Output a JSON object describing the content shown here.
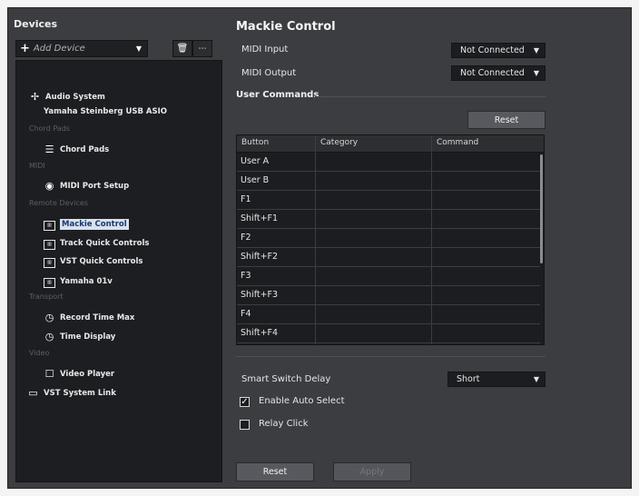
{
  "devices_panel": {
    "title": "Devices",
    "add_device_label": "Add Device",
    "tree": {
      "audio_system": "Audio System",
      "audio_driver": "Yamaha Steinberg USB ASIO",
      "cat_chord_pads": "Chord Pads",
      "chord_pads": "Chord Pads",
      "cat_midi": "MIDI",
      "midi_port_setup": "MIDI Port Setup",
      "cat_remote_devices": "Remote Devices",
      "mackie_control": "Mackie Control",
      "track_quick_controls": "Track Quick Controls",
      "vst_quick_controls": "VST Quick Controls",
      "yamaha_01v": "Yamaha 01v",
      "cat_transport": "Transport",
      "record_time_max": "Record Time Max",
      "time_display": "Time Display",
      "cat_video": "Video",
      "video_player": "Video Player",
      "vst_system_link": "VST System Link"
    }
  },
  "settings": {
    "title": "Mackie Control",
    "midi_input_label": "MIDI Input",
    "midi_input_value": "Not Connected",
    "midi_output_label": "MIDI Output",
    "midi_output_value": "Not Connected",
    "user_commands_label": "User Commands",
    "reset_top_label": "Reset",
    "table": {
      "columns": [
        "Button",
        "Category",
        "Command"
      ],
      "rows": [
        "User A",
        "User B",
        "F1",
        "Shift+F1",
        "F2",
        "Shift+F2",
        "F3",
        "Shift+F3",
        "F4",
        "Shift+F4"
      ]
    },
    "smart_switch_delay_label": "Smart Switch Delay",
    "smart_switch_delay_value": "Short",
    "enable_auto_select_label": "Enable Auto Select",
    "enable_auto_select_checked": true,
    "relay_click_label": "Relay Click",
    "relay_click_checked": false,
    "reset_bottom_label": "Reset",
    "apply_label": "Apply"
  },
  "colors": {
    "panel_bg": "#3c3d41",
    "list_bg": "#1d1e22",
    "selection_bg": "#d8e2ee",
    "selection_text": "#1a3a6e"
  }
}
